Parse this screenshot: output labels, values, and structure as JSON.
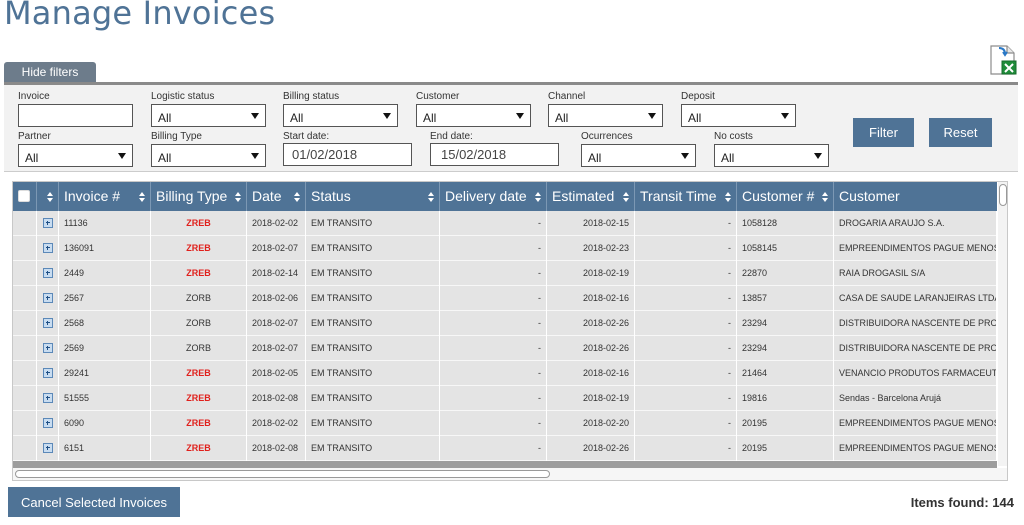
{
  "page": {
    "title": "Manage Invoices"
  },
  "toolbar": {
    "export_icon": "excel-export-icon"
  },
  "filters": {
    "toggle_label": "Hide filters",
    "invoice": {
      "label": "Invoice",
      "value": ""
    },
    "logistic_status": {
      "label": "Logistic status",
      "value": "All"
    },
    "billing_status": {
      "label": "Billing status",
      "value": "All"
    },
    "customer": {
      "label": "Customer",
      "value": "All"
    },
    "channel": {
      "label": "Channel",
      "value": "All"
    },
    "deposit": {
      "label": "Deposit",
      "value": "All"
    },
    "partner": {
      "label": "Partner",
      "value": "All"
    },
    "billing_type": {
      "label": "Billing Type",
      "value": "All"
    },
    "start_date": {
      "label": "Start date:",
      "value": "01/02/2018"
    },
    "end_date": {
      "label": "End date:",
      "value": "15/02/2018"
    },
    "ocurrences": {
      "label": "Ocurrences",
      "value": "All"
    },
    "no_costs": {
      "label": "No costs",
      "value": "All"
    },
    "filter_button": "Filter",
    "reset_button": "Reset"
  },
  "table": {
    "columns": [
      "Invoice #",
      "Billing Type",
      "Date",
      "Status",
      "Delivery date",
      "Estimated",
      "Transit Time",
      "Customer #",
      "Customer"
    ],
    "rows": [
      {
        "invoice": "11136",
        "billing_type": "ZREB",
        "date": "2018-02-02",
        "status": "EM TRANSITO",
        "delivery_date": "-",
        "estimated": "2018-02-15",
        "transit_time": "-",
        "customer_no": "1058128",
        "customer": "DROGARIA ARAUJO S.A."
      },
      {
        "invoice": "136091",
        "billing_type": "ZREB",
        "date": "2018-02-07",
        "status": "EM TRANSITO",
        "delivery_date": "-",
        "estimated": "2018-02-23",
        "transit_time": "-",
        "customer_no": "1058145",
        "customer": "EMPREENDIMENTOS PAGUE MENOS S"
      },
      {
        "invoice": "2449",
        "billing_type": "ZREB",
        "date": "2018-02-14",
        "status": "EM TRANSITO",
        "delivery_date": "-",
        "estimated": "2018-02-19",
        "transit_time": "-",
        "customer_no": "22870",
        "customer": "RAIA DROGASIL S/A"
      },
      {
        "invoice": "2567",
        "billing_type": "ZORB",
        "date": "2018-02-06",
        "status": "EM TRANSITO",
        "delivery_date": "-",
        "estimated": "2018-02-16",
        "transit_time": "-",
        "customer_no": "13857",
        "customer": "CASA DE SAUDE LARANJEIRAS LTDA - I"
      },
      {
        "invoice": "2568",
        "billing_type": "ZORB",
        "date": "2018-02-07",
        "status": "EM TRANSITO",
        "delivery_date": "-",
        "estimated": "2018-02-26",
        "transit_time": "-",
        "customer_no": "23294",
        "customer": "DISTRIBUIDORA NASCENTE DE PRODU"
      },
      {
        "invoice": "2569",
        "billing_type": "ZORB",
        "date": "2018-02-07",
        "status": "EM TRANSITO",
        "delivery_date": "-",
        "estimated": "2018-02-26",
        "transit_time": "-",
        "customer_no": "23294",
        "customer": "DISTRIBUIDORA NASCENTE DE PRODU"
      },
      {
        "invoice": "29241",
        "billing_type": "ZREB",
        "date": "2018-02-05",
        "status": "EM TRANSITO",
        "delivery_date": "-",
        "estimated": "2018-02-16",
        "transit_time": "-",
        "customer_no": "21464",
        "customer": "VENANCIO PRODUTOS FARMACEUTIC"
      },
      {
        "invoice": "51555",
        "billing_type": "ZREB",
        "date": "2018-02-08",
        "status": "EM TRANSITO",
        "delivery_date": "-",
        "estimated": "2018-02-19",
        "transit_time": "-",
        "customer_no": "19816",
        "customer": "Sendas - Barcelona Arujá"
      },
      {
        "invoice": "6090",
        "billing_type": "ZREB",
        "date": "2018-02-02",
        "status": "EM TRANSITO",
        "delivery_date": "-",
        "estimated": "2018-02-20",
        "transit_time": "-",
        "customer_no": "20195",
        "customer": "EMPREENDIMENTOS PAGUE MENOS S"
      },
      {
        "invoice": "6151",
        "billing_type": "ZREB",
        "date": "2018-02-08",
        "status": "EM TRANSITO",
        "delivery_date": "-",
        "estimated": "2018-02-26",
        "transit_time": "-",
        "customer_no": "20195",
        "customer": "EMPREENDIMENTOS PAGUE MENOS S"
      }
    ]
  },
  "footer": {
    "cancel_button": "Cancel Selected Invoices",
    "items_found": "Items found: 144"
  },
  "colors": {
    "accent": "#4f7396",
    "zreb": "#e0201c",
    "row_bg": "#e4e4e4"
  }
}
